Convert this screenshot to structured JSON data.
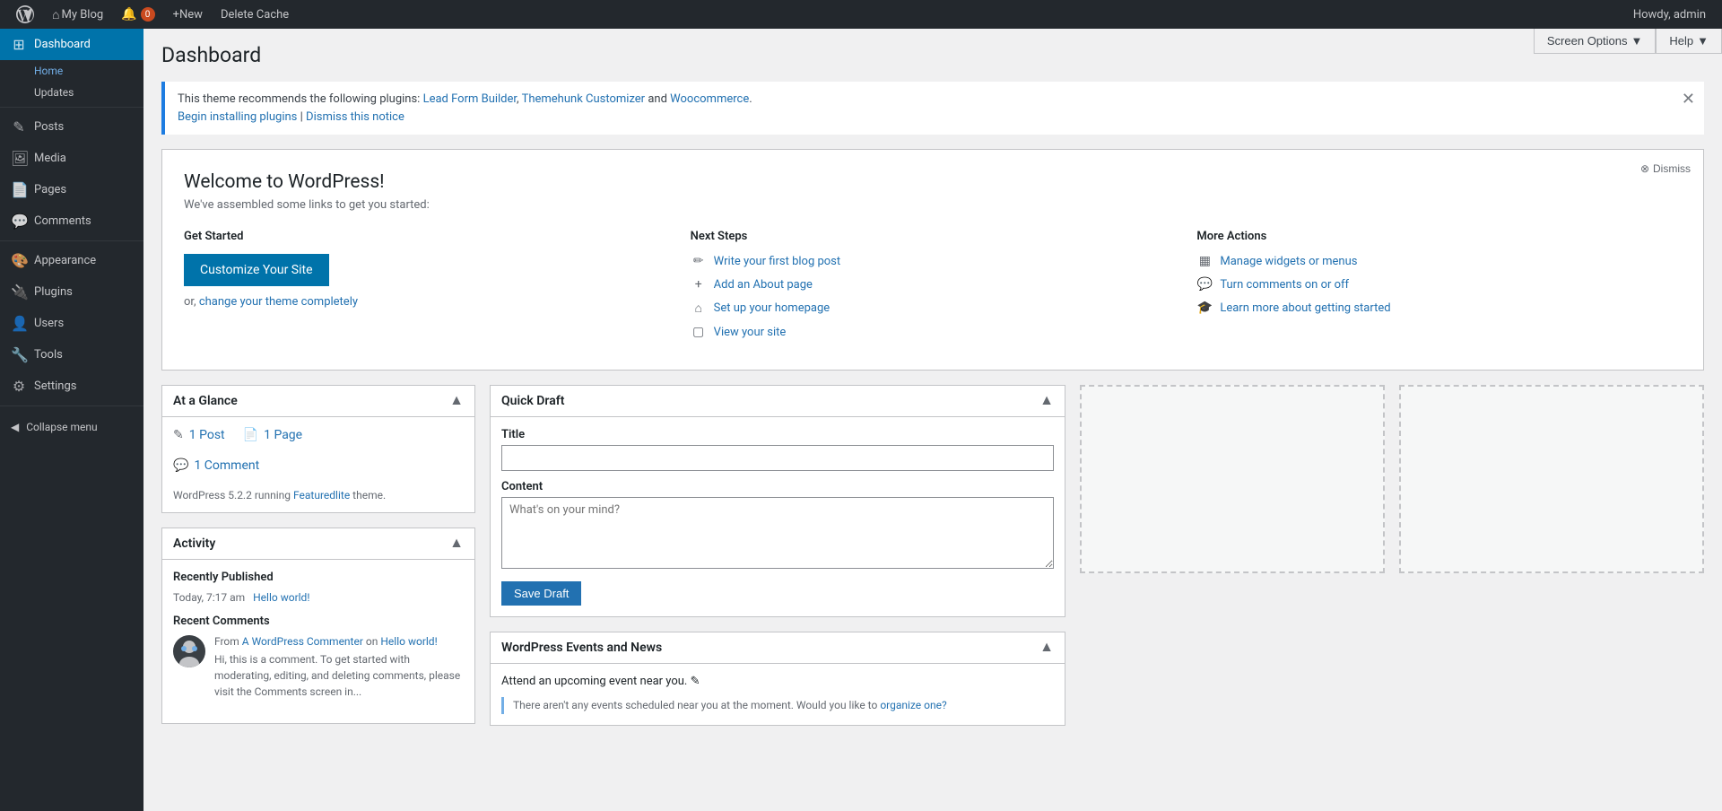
{
  "adminbar": {
    "wp_logo_label": "WordPress",
    "site_name": "My Blog",
    "notifications_count": "0",
    "new_label": "New",
    "delete_cache_label": "Delete Cache",
    "screen_options_label": "Screen Options",
    "help_label": "Help",
    "howdy_label": "Howdy, admin"
  },
  "sidebar": {
    "dashboard_label": "Dashboard",
    "home_label": "Home",
    "updates_label": "Updates",
    "posts_label": "Posts",
    "media_label": "Media",
    "pages_label": "Pages",
    "comments_label": "Comments",
    "appearance_label": "Appearance",
    "plugins_label": "Plugins",
    "users_label": "Users",
    "tools_label": "Tools",
    "settings_label": "Settings",
    "collapse_label": "Collapse menu"
  },
  "page": {
    "title": "Dashboard"
  },
  "notice": {
    "text": "This theme recommends the following plugins:",
    "plugin1": "Lead Form Builder",
    "plugin2": "Themehunk Customizer",
    "and_text": "and",
    "plugin3": "Woocommerce",
    "period": ".",
    "install_link": "Begin installing plugins",
    "dismiss_link": "Dismiss this notice"
  },
  "welcome": {
    "title": "Welcome to WordPress!",
    "subtitle": "We've assembled some links to get you started:",
    "dismiss_label": "Dismiss",
    "get_started": {
      "heading": "Get Started",
      "customize_btn": "Customize Your Site",
      "or_text": "or,",
      "theme_link": "change your theme completely"
    },
    "next_steps": {
      "heading": "Next Steps",
      "items": [
        {
          "icon": "✏",
          "text": "Write your first blog post",
          "url": "#"
        },
        {
          "icon": "+",
          "text": "Add an About page",
          "url": "#"
        },
        {
          "icon": "⌂",
          "text": "Set up your homepage",
          "url": "#"
        },
        {
          "icon": "▢",
          "text": "View your site",
          "url": "#"
        }
      ]
    },
    "more_actions": {
      "heading": "More Actions",
      "items": [
        {
          "icon": "▦",
          "text1": "Manage widgets or menus",
          "url": "#"
        },
        {
          "icon": "💬",
          "text1": "Turn comments on or off",
          "url": "#"
        },
        {
          "icon": "🎓",
          "text1": "Learn more about getting started",
          "url": "#"
        }
      ]
    }
  },
  "at_a_glance": {
    "title": "At a Glance",
    "post_count": "1",
    "post_label": "Post",
    "page_count": "1",
    "page_label": "Page",
    "comment_count": "1",
    "comment_label": "Comment",
    "version_text": "WordPress 5.2.2 running",
    "theme_name": "Featuredlite",
    "theme_suffix": "theme."
  },
  "quick_draft": {
    "title": "Quick Draft",
    "title_label": "Title",
    "title_placeholder": "",
    "content_label": "Content",
    "content_placeholder": "What's on your mind?",
    "save_btn": "Save Draft"
  },
  "activity": {
    "title": "Activity",
    "recently_published_heading": "Recently Published",
    "post_date": "Today, 7:17 am",
    "post_title": "Hello world!",
    "post_url": "#",
    "recent_comments_heading": "Recent Comments",
    "comment": {
      "author": "A WordPress Commenter",
      "author_url": "#",
      "on_text": "on",
      "post": "Hello world!",
      "post_url": "#",
      "content": "Hi, this is a comment. To get started with moderating, editing, and deleting comments, please visit the Comments screen in..."
    },
    "from_label": "From"
  },
  "events": {
    "title": "WordPress Events and News",
    "intro": "Attend an upcoming event near you.",
    "no_events_text": "There aren't any events scheduled near you at the moment.",
    "organize_text": "Would you like to",
    "organize_link": "organize one?",
    "edit_icon": "✎"
  }
}
